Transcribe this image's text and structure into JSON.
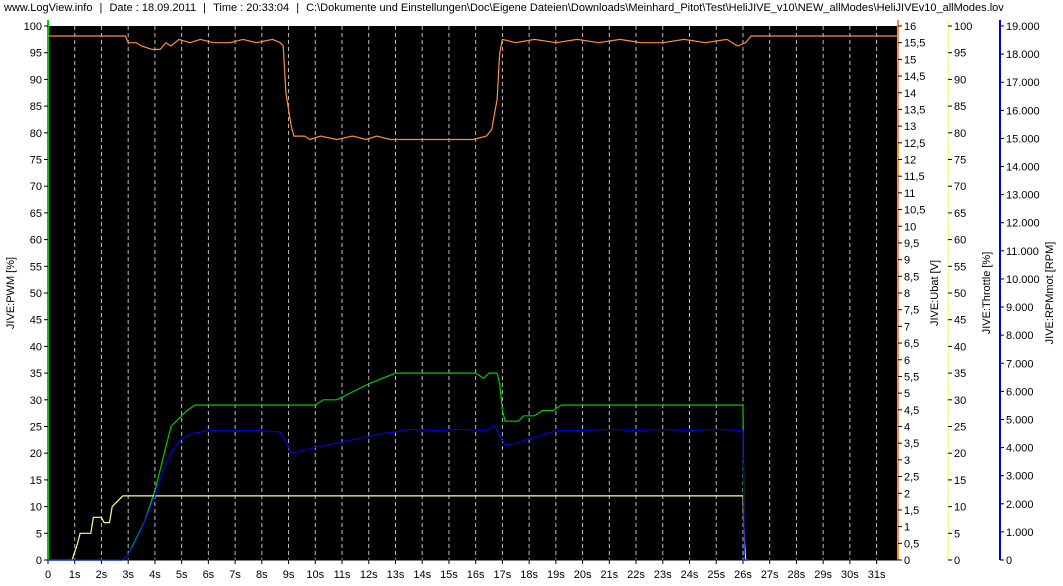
{
  "header": {
    "site": "www.LogView.info",
    "date": "Date : 18.09.2011",
    "time": "Time : 20:33:04",
    "path": "C:\\Dokumente und Einstellungen\\Doc\\Eigene Dateien\\Downloads\\Meinhard_Pitot\\Test\\HeliJIVE_v10\\NEW_allModes\\HeliJIVEv10_allModes.lov",
    "separator": "|"
  },
  "colors": {
    "plot_bg": "#000000",
    "grid": "#bfbfbf",
    "pwm": "#00cc00",
    "ubat": "#ff8c40",
    "throttle": "#ffff99",
    "rpm": "#0000dd"
  },
  "chart_data": {
    "type": "line",
    "x_axis": {
      "unit": "s",
      "min": 0,
      "max": 31.8,
      "ticks": [
        0,
        1,
        2,
        3,
        4,
        5,
        6,
        7,
        8,
        9,
        10,
        11,
        12,
        13,
        14,
        15,
        16,
        17,
        18,
        19,
        20,
        21,
        22,
        23,
        24,
        25,
        26,
        27,
        28,
        29,
        30,
        31
      ],
      "tick_labels": [
        "0",
        "1s",
        "2s",
        "3s",
        "4s",
        "5s",
        "6s",
        "7s",
        "8s",
        "9s",
        "10s",
        "11s",
        "12s",
        "13s",
        "14s",
        "15s",
        "16s",
        "17s",
        "18s",
        "19s",
        "20s",
        "21s",
        "22s",
        "23s",
        "24s",
        "25s",
        "26s",
        "27s",
        "28s",
        "29s",
        "30s",
        "31s"
      ],
      "grid": "dashed vertical at each second"
    },
    "axes": [
      {
        "id": "pwm",
        "label": "JIVE:PWM [%]",
        "side": "left",
        "min": 0,
        "max": 100,
        "color": "#00cc00",
        "ticks": [
          "0",
          "5",
          "10",
          "15",
          "20",
          "25",
          "30",
          "35",
          "40",
          "45",
          "50",
          "55",
          "60",
          "65",
          "70",
          "75",
          "80",
          "85",
          "90",
          "95",
          "100"
        ]
      },
      {
        "id": "ubat",
        "label": "JIVE:Ubat [V]",
        "side": "right",
        "min": 0,
        "max": 16,
        "color": "#ff8c40",
        "ticks": [
          "0",
          "0,5",
          "1",
          "1,5",
          "2",
          "2,5",
          "3",
          "3,5",
          "4",
          "4,5",
          "5",
          "5,5",
          "6",
          "6,5",
          "7",
          "7,5",
          "8",
          "8,5",
          "9",
          "9,5",
          "10",
          "10,5",
          "11",
          "11,5",
          "12",
          "12,5",
          "13",
          "13,5",
          "14",
          "14,5",
          "15",
          "15,5",
          "16"
        ]
      },
      {
        "id": "throttle",
        "label": "JIVE:Throttle [%]",
        "side": "right",
        "min": 0,
        "max": 100,
        "color": "#ffff99",
        "ticks": [
          "0",
          "5",
          "10",
          "15",
          "20",
          "25",
          "30",
          "35",
          "40",
          "45",
          "50",
          "55",
          "60",
          "65",
          "70",
          "75",
          "80",
          "85",
          "90",
          "95",
          "100"
        ]
      },
      {
        "id": "rpm",
        "label": "JIVE:RPMmot [RPM]",
        "side": "right",
        "min": 0,
        "max": 19000,
        "color": "#0000dd",
        "ticks": [
          "0",
          "1.000",
          "2.000",
          "3.000",
          "4.000",
          "5.000",
          "6.000",
          "7.000",
          "8.000",
          "9.000",
          "10.000",
          "11.000",
          "12.000",
          "13.000",
          "14.000",
          "15.000",
          "16.000",
          "17.000",
          "18.000",
          "19.000"
        ]
      }
    ],
    "series": [
      {
        "name": "JIVE:Ubat [V]",
        "axis": "ubat",
        "points": [
          [
            0,
            15.7
          ],
          [
            2.9,
            15.7
          ],
          [
            3.0,
            15.5
          ],
          [
            3.3,
            15.5
          ],
          [
            3.5,
            15.4
          ],
          [
            3.9,
            15.3
          ],
          [
            4.2,
            15.3
          ],
          [
            4.4,
            15.5
          ],
          [
            4.6,
            15.4
          ],
          [
            4.9,
            15.6
          ],
          [
            5.3,
            15.5
          ],
          [
            5.7,
            15.6
          ],
          [
            6.2,
            15.5
          ],
          [
            6.8,
            15.5
          ],
          [
            7.3,
            15.6
          ],
          [
            7.8,
            15.5
          ],
          [
            8.4,
            15.6
          ],
          [
            8.7,
            15.5
          ],
          [
            8.8,
            15.4
          ],
          [
            8.9,
            14.0
          ],
          [
            9.1,
            13.0
          ],
          [
            9.2,
            12.7
          ],
          [
            9.6,
            12.7
          ],
          [
            9.8,
            12.6
          ],
          [
            10.2,
            12.7
          ],
          [
            10.8,
            12.6
          ],
          [
            11.4,
            12.7
          ],
          [
            11.9,
            12.6
          ],
          [
            12.3,
            12.7
          ],
          [
            12.8,
            12.6
          ],
          [
            13.4,
            12.6
          ],
          [
            14.1,
            12.6
          ],
          [
            14.7,
            12.6
          ],
          [
            15.4,
            12.6
          ],
          [
            15.9,
            12.6
          ],
          [
            16.4,
            12.7
          ],
          [
            16.6,
            12.9
          ],
          [
            16.8,
            13.8
          ],
          [
            16.9,
            15.2
          ],
          [
            17.0,
            15.6
          ],
          [
            17.5,
            15.5
          ],
          [
            18.2,
            15.6
          ],
          [
            19.0,
            15.5
          ],
          [
            19.8,
            15.6
          ],
          [
            20.6,
            15.5
          ],
          [
            21.4,
            15.6
          ],
          [
            22.2,
            15.5
          ],
          [
            23.0,
            15.5
          ],
          [
            23.8,
            15.6
          ],
          [
            24.6,
            15.5
          ],
          [
            25.4,
            15.6
          ],
          [
            25.8,
            15.4
          ],
          [
            26.1,
            15.5
          ],
          [
            26.3,
            15.7
          ],
          [
            31.8,
            15.7
          ]
        ]
      },
      {
        "name": "JIVE:PWM [%]",
        "axis": "pwm",
        "points": [
          [
            0,
            0
          ],
          [
            2.8,
            0
          ],
          [
            3.0,
            1
          ],
          [
            3.2,
            3
          ],
          [
            3.4,
            5
          ],
          [
            3.6,
            7
          ],
          [
            3.8,
            10
          ],
          [
            4.0,
            13
          ],
          [
            4.2,
            17
          ],
          [
            4.4,
            21
          ],
          [
            4.6,
            25
          ],
          [
            4.8,
            26
          ],
          [
            5.0,
            27
          ],
          [
            5.2,
            28
          ],
          [
            5.5,
            29
          ],
          [
            6.0,
            29
          ],
          [
            7.0,
            29
          ],
          [
            8.0,
            29
          ],
          [
            9.0,
            29
          ],
          [
            10.0,
            29
          ],
          [
            10.3,
            30
          ],
          [
            10.8,
            30
          ],
          [
            11.2,
            31
          ],
          [
            11.6,
            32
          ],
          [
            12.0,
            33
          ],
          [
            12.5,
            34
          ],
          [
            13.0,
            35
          ],
          [
            14.0,
            35
          ],
          [
            15.0,
            35
          ],
          [
            16.0,
            35
          ],
          [
            16.3,
            34
          ],
          [
            16.5,
            35
          ],
          [
            16.8,
            35
          ],
          [
            16.9,
            33
          ],
          [
            17.0,
            28
          ],
          [
            17.1,
            26
          ],
          [
            17.6,
            26
          ],
          [
            17.8,
            27
          ],
          [
            18.2,
            27
          ],
          [
            18.5,
            28
          ],
          [
            18.9,
            28
          ],
          [
            19.2,
            29
          ],
          [
            20.0,
            29
          ],
          [
            21.0,
            29
          ],
          [
            22.0,
            29
          ],
          [
            23.0,
            29
          ],
          [
            24.0,
            29
          ],
          [
            25.0,
            29
          ],
          [
            26.0,
            29
          ],
          [
            26.05,
            0
          ],
          [
            26.2,
            0
          ]
        ]
      },
      {
        "name": "JIVE:Throttle [%]",
        "axis": "throttle",
        "points": [
          [
            0,
            0
          ],
          [
            0.9,
            0
          ],
          [
            1.1,
            3
          ],
          [
            1.2,
            5
          ],
          [
            1.6,
            5
          ],
          [
            1.7,
            8
          ],
          [
            2.0,
            8
          ],
          [
            2.1,
            7
          ],
          [
            2.3,
            7
          ],
          [
            2.4,
            10
          ],
          [
            2.6,
            11
          ],
          [
            2.8,
            12
          ],
          [
            3.0,
            12
          ],
          [
            6.0,
            12
          ],
          [
            10.0,
            12
          ],
          [
            15.0,
            12
          ],
          [
            20.0,
            12
          ],
          [
            26.0,
            12
          ],
          [
            26.05,
            4
          ],
          [
            26.1,
            0
          ],
          [
            26.2,
            0
          ]
        ]
      },
      {
        "name": "JIVE:RPMmot [RPM]",
        "axis": "rpm",
        "points": [
          [
            0,
            0
          ],
          [
            2.8,
            0
          ],
          [
            3.0,
            200
          ],
          [
            3.2,
            500
          ],
          [
            3.4,
            900
          ],
          [
            3.6,
            1300
          ],
          [
            3.8,
            1800
          ],
          [
            4.0,
            2300
          ],
          [
            4.2,
            2900
          ],
          [
            4.4,
            3400
          ],
          [
            4.6,
            3800
          ],
          [
            4.8,
            4100
          ],
          [
            5.0,
            4300
          ],
          [
            5.4,
            4500
          ],
          [
            6.0,
            4600
          ],
          [
            7.0,
            4600
          ],
          [
            8.0,
            4600
          ],
          [
            8.7,
            4550
          ],
          [
            8.9,
            4200
          ],
          [
            9.1,
            3800
          ],
          [
            9.5,
            3900
          ],
          [
            10.0,
            4000
          ],
          [
            10.5,
            4100
          ],
          [
            11.0,
            4200
          ],
          [
            11.5,
            4300
          ],
          [
            12.0,
            4400
          ],
          [
            12.5,
            4500
          ],
          [
            13.0,
            4550
          ],
          [
            13.5,
            4650
          ],
          [
            14.5,
            4600
          ],
          [
            15.5,
            4650
          ],
          [
            16.4,
            4600
          ],
          [
            16.7,
            4800
          ],
          [
            16.9,
            4400
          ],
          [
            17.1,
            4100
          ],
          [
            17.5,
            4150
          ],
          [
            18.0,
            4300
          ],
          [
            18.5,
            4450
          ],
          [
            19.0,
            4600
          ],
          [
            20.0,
            4600
          ],
          [
            21.0,
            4650
          ],
          [
            22.0,
            4600
          ],
          [
            23.0,
            4650
          ],
          [
            24.0,
            4600
          ],
          [
            25.0,
            4650
          ],
          [
            26.0,
            4600
          ],
          [
            26.05,
            0
          ],
          [
            26.2,
            0
          ]
        ]
      }
    ]
  }
}
